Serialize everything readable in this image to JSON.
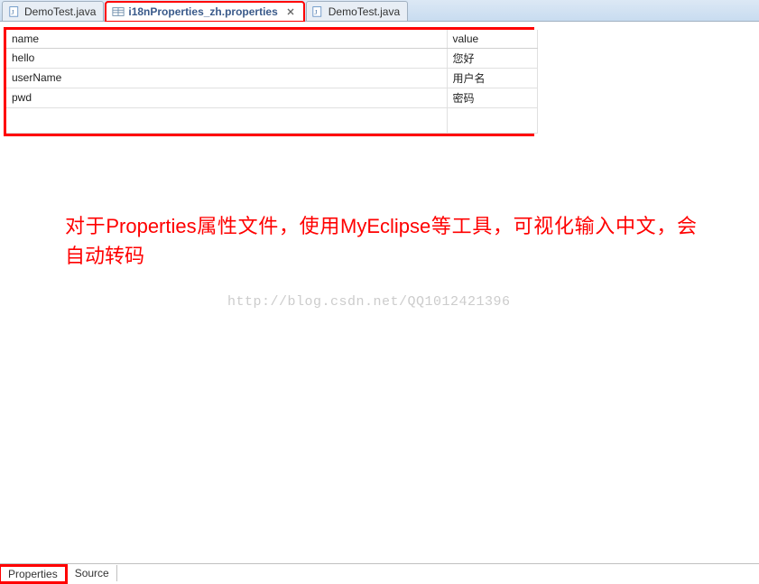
{
  "tabs": [
    {
      "label": "DemoTest.java",
      "type": "java",
      "active": false
    },
    {
      "label": "i18nProperties_zh.properties",
      "type": "properties",
      "active": true,
      "highlighted": true
    },
    {
      "label": "DemoTest.java",
      "type": "java",
      "active": false
    }
  ],
  "table": {
    "headers": {
      "name": "name",
      "value": "value"
    },
    "rows": [
      {
        "name": "hello",
        "value": "您好"
      },
      {
        "name": "userName",
        "value": "用户名"
      },
      {
        "name": "pwd",
        "value": "密码"
      }
    ]
  },
  "annotation": "对于Properties属性文件，使用MyEclipse等工具，可视化输入中文，会自动转码",
  "watermark": "http://blog.csdn.net/QQ1012421396",
  "bottomTabs": [
    {
      "label": "Properties",
      "active": true,
      "highlighted": true
    },
    {
      "label": "Source",
      "active": false
    }
  ]
}
